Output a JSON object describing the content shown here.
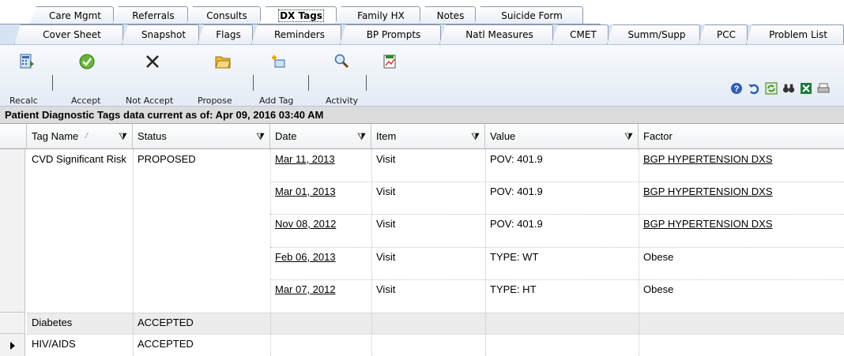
{
  "tabs_row1": [
    "Care Mgmt",
    "Referrals",
    "Consults",
    "DX Tags",
    "Family HX",
    "Notes",
    "Suicide Form"
  ],
  "tabs_row2": [
    "Cover Sheet",
    "Snapshot",
    "Flags",
    "Reminders",
    "BP Prompts",
    "Natl Measures",
    "CMET",
    "Summ/Supp",
    "PCC",
    "Problem List"
  ],
  "active_tab": "DX Tags",
  "toolbar": {
    "recalc": "Recalc",
    "accept": "Accept",
    "not_accept": "Not Accept",
    "propose": "Propose",
    "add_tag": "Add Tag",
    "activity": "Activity"
  },
  "caption": "Patient Diagnostic Tags data current as of: Apr 09, 2016 03:40 AM",
  "columns": [
    "Tag Name",
    "Status",
    "Date",
    "Item",
    "Value",
    "Factor"
  ],
  "rows": [
    {
      "tag": "CVD Significant Risk",
      "status": "PROPOSED",
      "details": [
        {
          "date": "Mar 11, 2013",
          "item": "Visit",
          "value": "POV: 401.9",
          "factor": "BGP HYPERTENSION DXS"
        },
        {
          "date": "Mar 01, 2013",
          "item": "Visit",
          "value": "POV: 401.9",
          "factor": "BGP HYPERTENSION DXS"
        },
        {
          "date": "Nov 08, 2012",
          "item": "Visit",
          "value": "POV: 401.9",
          "factor": "BGP HYPERTENSION DXS"
        },
        {
          "date": "Feb 06, 2013",
          "item": "Visit",
          "value": "TYPE: WT",
          "factor": "Obese"
        },
        {
          "date": "Mar 07, 2012",
          "item": "Visit",
          "value": "TYPE: HT",
          "factor": "Obese"
        }
      ]
    },
    {
      "tag": "Diabetes",
      "status": "ACCEPTED",
      "details": []
    },
    {
      "tag": "HIV/AIDS",
      "status": "ACCEPTED",
      "details": []
    }
  ],
  "icons": [
    "recalc-icon",
    "accept-check-icon",
    "not-accept-x-icon",
    "propose-folder-icon",
    "add-tag-icon",
    "activity-magnifier-icon",
    "report-icon",
    "help-icon",
    "undo-icon",
    "refresh-icon",
    "find-binoculars-icon",
    "excel-icon",
    "print-icon"
  ]
}
